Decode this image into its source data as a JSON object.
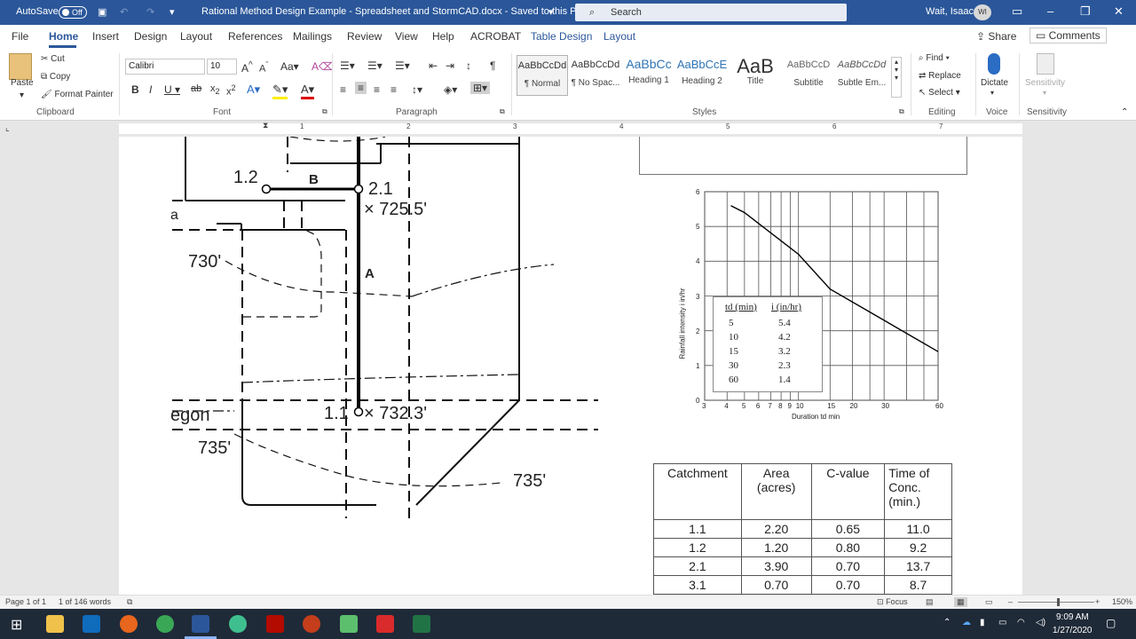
{
  "titlebar": {
    "autosave": "AutoSave",
    "autosave_state": "Off",
    "title": "Rational Method Design Example - Spreadsheet and StormCAD.docx  -  Saved to this PC",
    "search_placeholder": "Search",
    "user": "Wait, Isaac",
    "initials": "WI"
  },
  "tabs": [
    "File",
    "Home",
    "Insert",
    "Design",
    "Layout",
    "References",
    "Mailings",
    "Review",
    "View",
    "Help",
    "ACROBAT",
    "Table Design",
    "Layout"
  ],
  "share": "Share",
  "comments": "Comments",
  "ribbon": {
    "clipboard": {
      "paste": "Paste",
      "cut": "Cut",
      "copy": "Copy",
      "format_painter": "Format Painter",
      "label": "Clipboard"
    },
    "font": {
      "name": "Calibri",
      "size": "10",
      "label": "Font"
    },
    "paragraph": {
      "label": "Paragraph"
    },
    "styles": {
      "label": "Styles",
      "items": [
        {
          "sample": "AaBbCcDd",
          "name": "¶ Normal"
        },
        {
          "sample": "AaBbCcDd",
          "name": "¶ No Spac..."
        },
        {
          "sample": "AaBbCc",
          "name": "Heading 1"
        },
        {
          "sample": "AaBbCcE",
          "name": "Heading 2"
        },
        {
          "sample": "AaB",
          "name": "Title"
        },
        {
          "sample": "AaBbCcD",
          "name": "Subtitle"
        },
        {
          "sample": "AaBbCcDd",
          "name": "Subtle Em..."
        }
      ]
    },
    "editing": {
      "find": "Find",
      "replace": "Replace",
      "select": "Select",
      "label": "Editing"
    },
    "voice": {
      "dictate": "Dictate",
      "label": "Voice"
    },
    "sensitivity": {
      "name": "Sensitivity",
      "label": "Sensitivity"
    }
  },
  "ruler_numbers": [
    "1",
    "2",
    "3",
    "4",
    "5",
    "6",
    "7"
  ],
  "map": {
    "node_12": "1.2",
    "node_21": "2.1",
    "elev_7255": "× 725.5'",
    "label_b": "B",
    "label_a": "A",
    "contour_730": "730'",
    "node_11": "1.1",
    "elev_7323": "× 732.3'",
    "contour_735a": "735'",
    "contour_735b": "735'",
    "egon": "egon",
    "a_frag": "a"
  },
  "idf": {
    "ylabel": "Rainfall intensity i in/hr",
    "xlabel": "Duration td min",
    "yticks": [
      "0",
      "1",
      "2",
      "3",
      "4",
      "5",
      "6"
    ],
    "xticks": [
      "3",
      "4",
      "5",
      "6",
      "7",
      "8",
      "9",
      "10",
      "15",
      "20",
      "30",
      "60"
    ],
    "table_headers": [
      "td (min)",
      "i (in/hr)"
    ],
    "table_rows": [
      [
        "5",
        "5.4"
      ],
      [
        "10",
        "4.2"
      ],
      [
        "15",
        "3.2"
      ],
      [
        "30",
        "2.3"
      ],
      [
        "60",
        "1.4"
      ]
    ]
  },
  "catchments": {
    "headers": [
      "Catchment",
      "Area (acres)",
      "C-value",
      "Time of Conc. (min.)"
    ],
    "rows": [
      [
        "1.1",
        "2.20",
        "0.65",
        "11.0"
      ],
      [
        "1.2",
        "1.20",
        "0.80",
        "9.2"
      ],
      [
        "2.1",
        "3.90",
        "0.70",
        "13.7"
      ],
      [
        "3.1",
        "0.70",
        "0.70",
        "8.7"
      ]
    ]
  },
  "status": {
    "page": "Page 1 of 1",
    "words": "1 of 146 words",
    "focus": "Focus",
    "zoom": "150%"
  },
  "tray": {
    "time": "9:09 AM",
    "date": "1/27/2020"
  }
}
